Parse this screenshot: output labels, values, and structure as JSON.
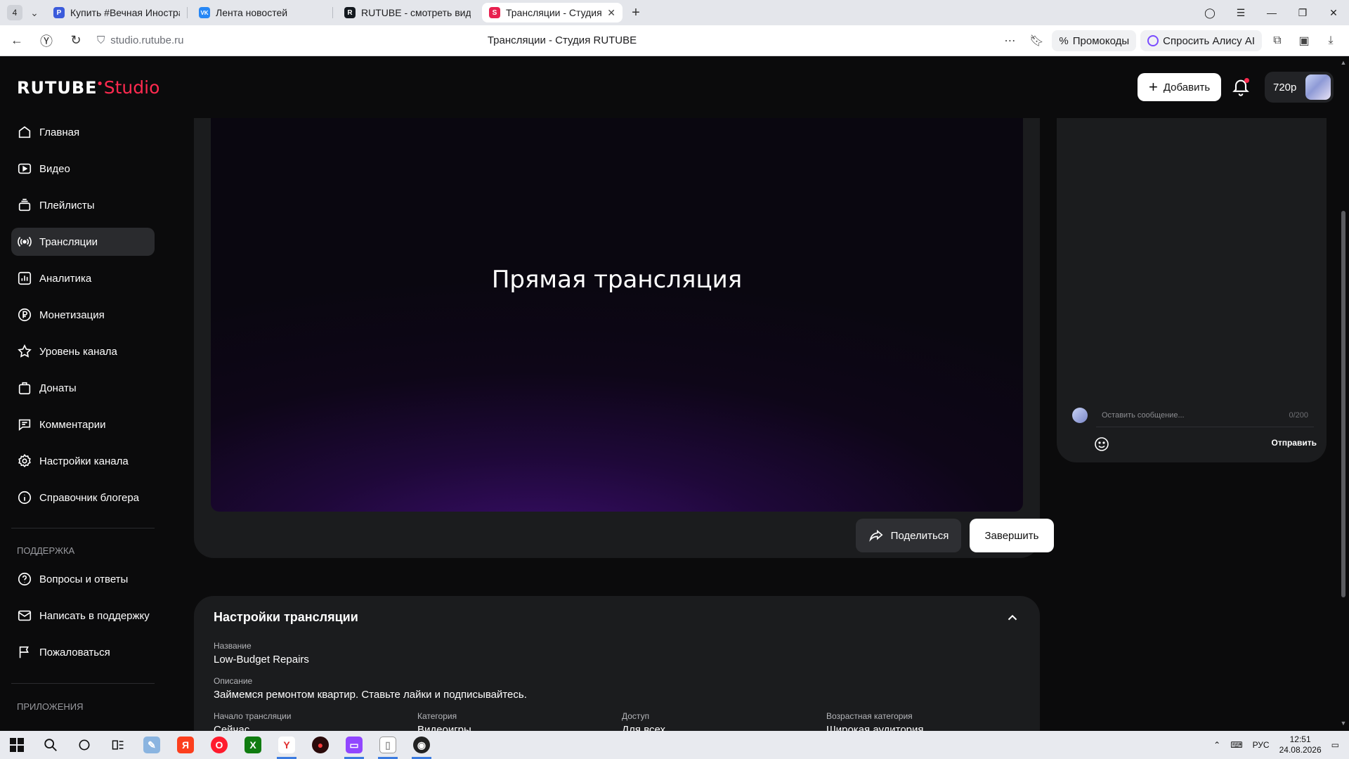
{
  "browser": {
    "tab_count": "4",
    "tabs": [
      {
        "label": "Купить #Вечная Иностра",
        "favicon": "P",
        "color": "#3b5bdb"
      },
      {
        "label": "Лента новостей",
        "favicon": "VK",
        "color": "#2787f5"
      },
      {
        "label": "RUTUBE - смотреть виде",
        "favicon": "R",
        "color": "#14191f"
      },
      {
        "label": "Трансляции - Студия R",
        "favicon": "S",
        "color": "#e8204f"
      }
    ],
    "url": "studio.rutube.ru",
    "page_title": "Трансляции - Студия RUTUBE",
    "promo_label": "Промокоды",
    "alice_label": "Спросить Алису AI"
  },
  "header": {
    "logo_main": "RUTUBE",
    "logo_sub": "Studio",
    "add_label": "Добавить",
    "quality": "720p"
  },
  "sidebar": {
    "items": [
      {
        "label": "Главная",
        "icon": "home-icon"
      },
      {
        "label": "Видео",
        "icon": "video-icon"
      },
      {
        "label": "Плейлисты",
        "icon": "playlist-icon"
      },
      {
        "label": "Трансляции",
        "icon": "broadcast-icon"
      },
      {
        "label": "Аналитика",
        "icon": "analytics-icon"
      },
      {
        "label": "Монетизация",
        "icon": "ruble-icon"
      },
      {
        "label": "Уровень канала",
        "icon": "star-icon"
      },
      {
        "label": "Донаты",
        "icon": "donate-icon"
      },
      {
        "label": "Комментарии",
        "icon": "comment-icon"
      },
      {
        "label": "Настройки канала",
        "icon": "gear-icon"
      },
      {
        "label": "Справочник блогера",
        "icon": "info-icon"
      }
    ],
    "support_heading": "ПОДДЕРЖКА",
    "support_items": [
      {
        "label": "Вопросы и ответы",
        "icon": "question-icon"
      },
      {
        "label": "Написать в поддержку",
        "icon": "mail-icon"
      },
      {
        "label": "Пожаловаться",
        "icon": "flag-icon"
      }
    ],
    "apps_heading": "ПРИЛОЖЕНИЯ"
  },
  "player": {
    "title": "Прямая трансляция",
    "share_label": "Поделиться",
    "finish_label": "Завершить"
  },
  "settings": {
    "title": "Настройки трансляции",
    "name_label": "Название",
    "name_value": "Low-Budget Repairs",
    "desc_label": "Описание",
    "desc_value": "Займемся ремонтом квартир. Ставьте лайки и подписывайтесь.",
    "start_label": "Начало трансляции",
    "start_value": "Сейчас",
    "category_label": "Категория",
    "category_value": "Видеоигры",
    "access_label": "Доступ",
    "access_value": "Для всех",
    "age_label": "Возрастная категория",
    "age_value": "Широкая аудитория"
  },
  "chat": {
    "placeholder": "Оставить сообщение...",
    "counter": "0/200",
    "send_label": "Отправить"
  },
  "taskbar": {
    "lang": "РУС",
    "time": "12:51",
    "date": "24.08.2026"
  },
  "colors": {
    "accent": "#ff2a4f",
    "active_nav": "#2a2b2e",
    "card": "#1b1c1e"
  }
}
